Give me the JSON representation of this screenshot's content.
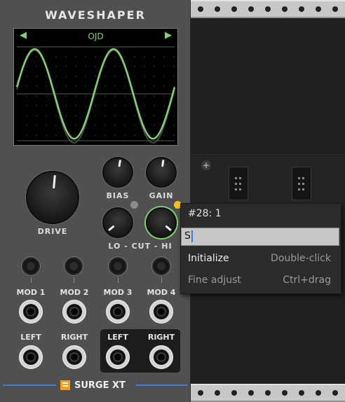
{
  "module": {
    "title": "WAVESHAPER",
    "screen": {
      "mode": "OJD",
      "prev_arrow": "◀",
      "next_arrow": "▶"
    },
    "knobs": {
      "drive": "DRIVE",
      "bias": "BIAS",
      "gain": "GAIN",
      "cut": "LO - CUT - HI"
    },
    "mod_labels": [
      "MOD 1",
      "MOD 2",
      "MOD 3",
      "MOD 4"
    ],
    "input_labels": {
      "left": "LEFT",
      "right": "RIGHT"
    },
    "output_labels": {
      "left": "LEFT",
      "right": "RIGHT"
    },
    "brand": "SURGE XT",
    "colors": {
      "accent": "#7ed36a",
      "brand": "#f59f1a",
      "led_on": "#f2c31c",
      "led_off": "#8c8c8c",
      "line": "#3e7fd0"
    }
  },
  "context_menu": {
    "title": "#28: 1",
    "field_value": "S",
    "items": [
      {
        "label": "Initialize",
        "shortcut": "Double-click"
      },
      {
        "label": "Fine adjust",
        "shortcut": "Ctrl+drag"
      }
    ]
  },
  "rack": {
    "add_button": "+"
  }
}
